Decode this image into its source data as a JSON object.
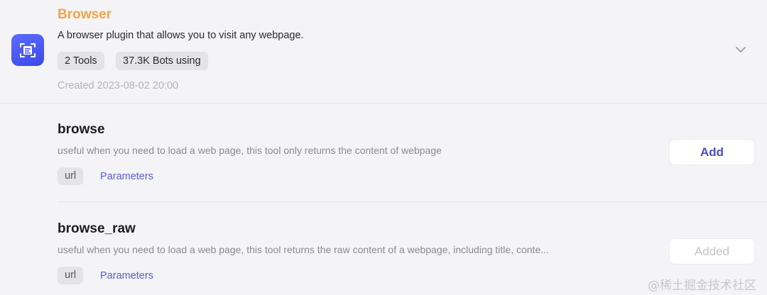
{
  "plugin": {
    "title": "Browser",
    "description": "A browser plugin that allows you to visit any webpage.",
    "tools_badge": "2 Tools",
    "bots_badge": "37.3K Bots using",
    "created": "Created 2023-08-02 20:00",
    "icon": "browser-plugin-icon",
    "title_color": "#f2a44a",
    "icon_color": "#4a55f0"
  },
  "tools": [
    {
      "name": "browse",
      "description": "useful when you need to load a web page, this tool only returns the content of webpage",
      "param": "url",
      "params_link": "Parameters",
      "action": "Add"
    },
    {
      "name": "browse_raw",
      "description": "useful when you need to load a web page, this tool returns the raw content of a webpage, including title, conte...",
      "param": "url",
      "params_link": "Parameters",
      "action": "Added"
    }
  ],
  "watermark": "@稀土掘金技术社区",
  "accent_color": "#4b4dc8"
}
